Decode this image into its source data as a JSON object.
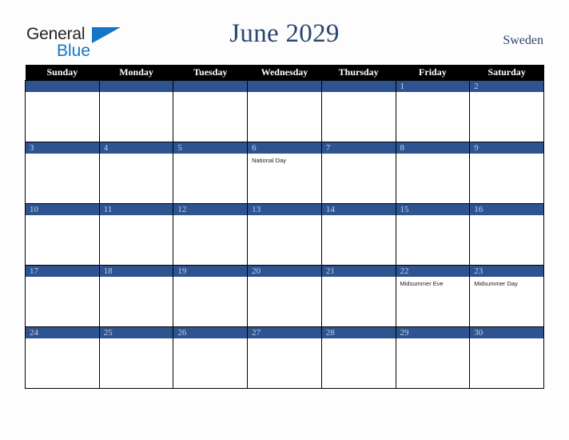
{
  "brand": {
    "name_part1": "General",
    "name_part2": "Blue",
    "triangle_color": "#1476c6"
  },
  "header": {
    "title": "June 2029",
    "country": "Sweden"
  },
  "colors": {
    "header_bar": "#000000",
    "date_band": "#2e5391",
    "date_number": "#ccd2de",
    "title_text": "#2b4570",
    "page_background": "#fdfdfd",
    "cell_background": "#ffffff",
    "grid_line": "#000000"
  },
  "weekdays": [
    "Sunday",
    "Monday",
    "Tuesday",
    "Wednesday",
    "Thursday",
    "Friday",
    "Saturday"
  ],
  "weeks": [
    [
      {
        "day": "",
        "event": ""
      },
      {
        "day": "",
        "event": ""
      },
      {
        "day": "",
        "event": ""
      },
      {
        "day": "",
        "event": ""
      },
      {
        "day": "",
        "event": ""
      },
      {
        "day": "1",
        "event": ""
      },
      {
        "day": "2",
        "event": ""
      }
    ],
    [
      {
        "day": "3",
        "event": ""
      },
      {
        "day": "4",
        "event": ""
      },
      {
        "day": "5",
        "event": ""
      },
      {
        "day": "6",
        "event": "National Day"
      },
      {
        "day": "7",
        "event": ""
      },
      {
        "day": "8",
        "event": ""
      },
      {
        "day": "9",
        "event": ""
      }
    ],
    [
      {
        "day": "10",
        "event": ""
      },
      {
        "day": "11",
        "event": ""
      },
      {
        "day": "12",
        "event": ""
      },
      {
        "day": "13",
        "event": ""
      },
      {
        "day": "14",
        "event": ""
      },
      {
        "day": "15",
        "event": ""
      },
      {
        "day": "16",
        "event": ""
      }
    ],
    [
      {
        "day": "17",
        "event": ""
      },
      {
        "day": "18",
        "event": ""
      },
      {
        "day": "19",
        "event": ""
      },
      {
        "day": "20",
        "event": ""
      },
      {
        "day": "21",
        "event": ""
      },
      {
        "day": "22",
        "event": "Midsummer Eve"
      },
      {
        "day": "23",
        "event": "Midsummer Day"
      }
    ],
    [
      {
        "day": "24",
        "event": ""
      },
      {
        "day": "25",
        "event": ""
      },
      {
        "day": "26",
        "event": ""
      },
      {
        "day": "27",
        "event": ""
      },
      {
        "day": "28",
        "event": ""
      },
      {
        "day": "29",
        "event": ""
      },
      {
        "day": "30",
        "event": ""
      }
    ]
  ]
}
